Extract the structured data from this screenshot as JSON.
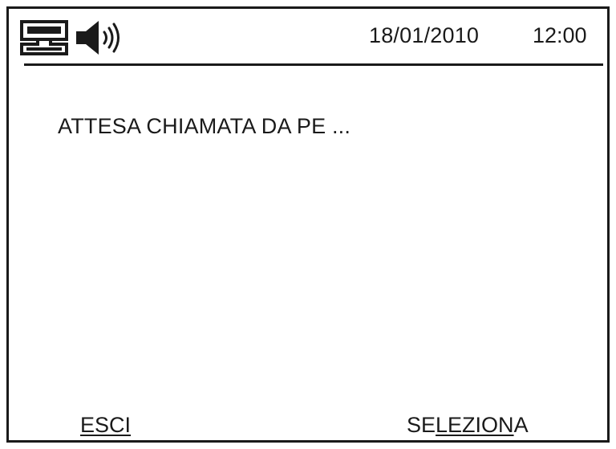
{
  "status_bar": {
    "icons": [
      "network-icon",
      "speaker-icon"
    ],
    "date": "18/01/2010",
    "time": "12:00"
  },
  "message": "ATTESA CHIAMATA DA PE ...",
  "softkeys": {
    "left": {
      "label": "ESCI",
      "label_underlined": "ESCI"
    },
    "right": {
      "label": "SELEZIONA",
      "label_prefix": "SE",
      "label_underlined": "LEZION",
      "label_suffix": "A"
    }
  },
  "colors": {
    "foreground": "#1a1a1a",
    "background": "#ffffff"
  }
}
